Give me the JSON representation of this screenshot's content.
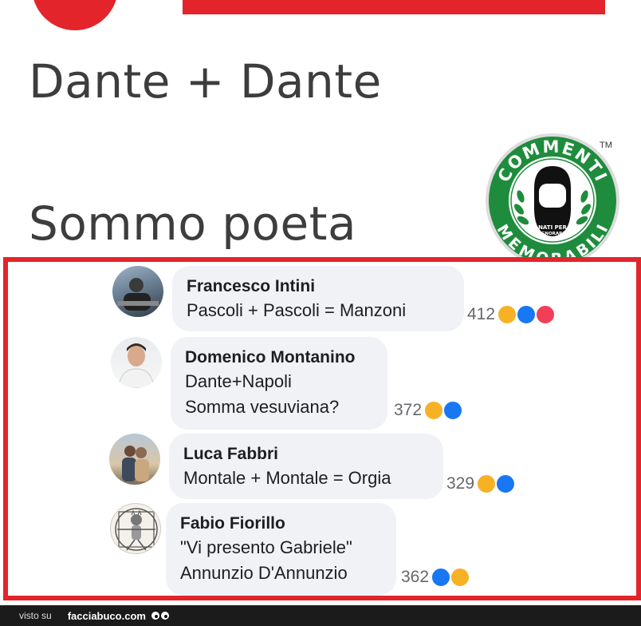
{
  "headline": {
    "line1": "Dante + Dante",
    "line2": "Sommo poeta"
  },
  "logo": {
    "top_text": "COMMENTI",
    "bottom_text": "MEMORABILI",
    "tagline_1": "NATI PER",
    "tagline_2": "IGNORARE",
    "tm": "TM",
    "color": "#1e8c3c"
  },
  "comments": [
    {
      "author": "Francesco  Intini",
      "lines": [
        "Pascoli + Pascoli = Manzoni"
      ],
      "count": "412",
      "reactions": [
        "haha-icon",
        "like-icon",
        "love-icon"
      ]
    },
    {
      "author": "Domenico Montanino",
      "lines": [
        "Dante+Napoli",
        "Somma vesuviana?"
      ],
      "count": "372",
      "reactions": [
        "haha-icon",
        "like-icon"
      ]
    },
    {
      "author": "Luca Fabbri",
      "lines": [
        "Montale + Montale = Orgia"
      ],
      "count": "329",
      "reactions": [
        "haha-icon",
        "like-icon"
      ]
    },
    {
      "author": "Fabio Fiorillo",
      "lines": [
        "\"Vi presento Gabriele\"",
        "Annunzio D'Annunzio"
      ],
      "count": "362",
      "reactions": [
        "like-icon",
        "haha-icon"
      ]
    }
  ],
  "footer": {
    "visto": "visto su",
    "site": "facciabuco.com"
  },
  "colors": {
    "frame": "#e3242b",
    "like": "#1877f2",
    "haha": "#f7b125",
    "love": "#f33e58"
  }
}
